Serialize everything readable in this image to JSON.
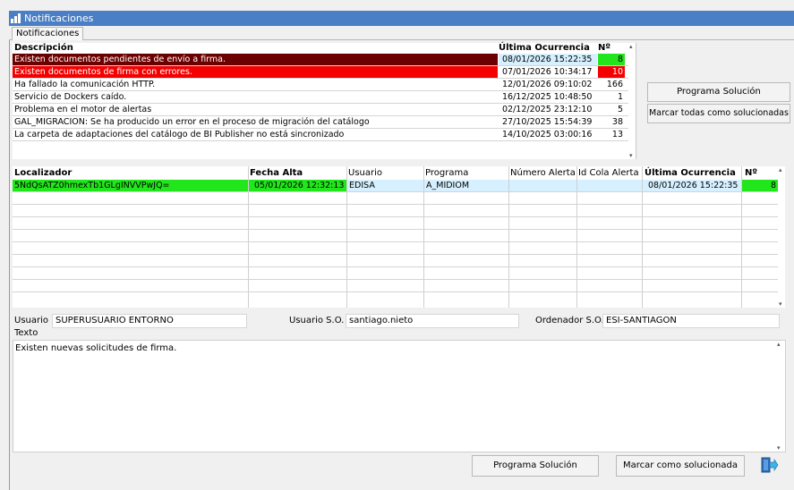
{
  "window": {
    "title": "Notificaciones"
  },
  "tabs": [
    {
      "label": "Notificaciones"
    }
  ],
  "notifications_table": {
    "columns": [
      "Descripción",
      "Última Ocurrencia",
      "Nº"
    ],
    "rows": [
      {
        "descripcion": "Existen documentos pendientes de envío a firma.",
        "ultima": "08/01/2026 15:22:35",
        "num": "8"
      },
      {
        "descripcion": "Existen documentos de firma con errores.",
        "ultima": "07/01/2026 10:34:17",
        "num": "10"
      },
      {
        "descripcion": "Ha fallado la comunicación HTTP.",
        "ultima": "12/01/2026 09:10:02",
        "num": "166"
      },
      {
        "descripcion": "Servicio de Dockers caído.",
        "ultima": "16/12/2025 10:48:50",
        "num": "1"
      },
      {
        "descripcion": "Problema en el motor de alertas",
        "ultima": "02/12/2025 23:12:10",
        "num": "5"
      },
      {
        "descripcion": "GAL_MIGRACION: Se ha producido un error en el proceso de migración del catálogo",
        "ultima": "27/10/2025 15:54:39",
        "num": "38"
      },
      {
        "descripcion": "La carpeta de adaptaciones del catálogo de BI Publisher no está sincronizado",
        "ultima": "14/10/2025 03:00:16",
        "num": "13"
      }
    ]
  },
  "side_buttons": {
    "programa_solucion": "Programa Solución",
    "marcar_todas": "Marcar todas como solucionadas"
  },
  "detail_table": {
    "columns": [
      "Localizador",
      "Fecha Alta",
      "Usuario",
      "Programa",
      "Número Alerta",
      "Id Cola Alerta",
      "Última Ocurrencia",
      "Nº"
    ],
    "rows": [
      {
        "localizador": "5NdQsATZ0hmexTb1GLgINVVPwJQ=",
        "fecha_alta": "05/01/2026 12:32:13",
        "usuario": "EDISA",
        "programa": "A_MIDIOM",
        "numero_alerta": "",
        "id_cola": "",
        "ultima": "08/01/2026 15:22:35",
        "num": "8"
      }
    ]
  },
  "info": {
    "usuario_label": "Usuario",
    "usuario_value": "SUPERUSUARIO ENTORNO",
    "usuario_so_label": "Usuario S.O.",
    "usuario_so_value": "santiago.nieto",
    "ordenador_label": "Ordenador S.O.",
    "ordenador_value": "ESI-SANTIAGON"
  },
  "texto": {
    "label": "Texto",
    "value": "Existen nuevas solicitudes de firma."
  },
  "bottom_buttons": {
    "programa_solucion": "Programa Solución",
    "marcar_solucionada": "Marcar como solucionada"
  },
  "colors": {
    "titlebar": "#4a7fc6",
    "dark_red": "#6b0000",
    "red": "#f40000",
    "green": "#22e61c",
    "selection": "#d6f0ff"
  }
}
